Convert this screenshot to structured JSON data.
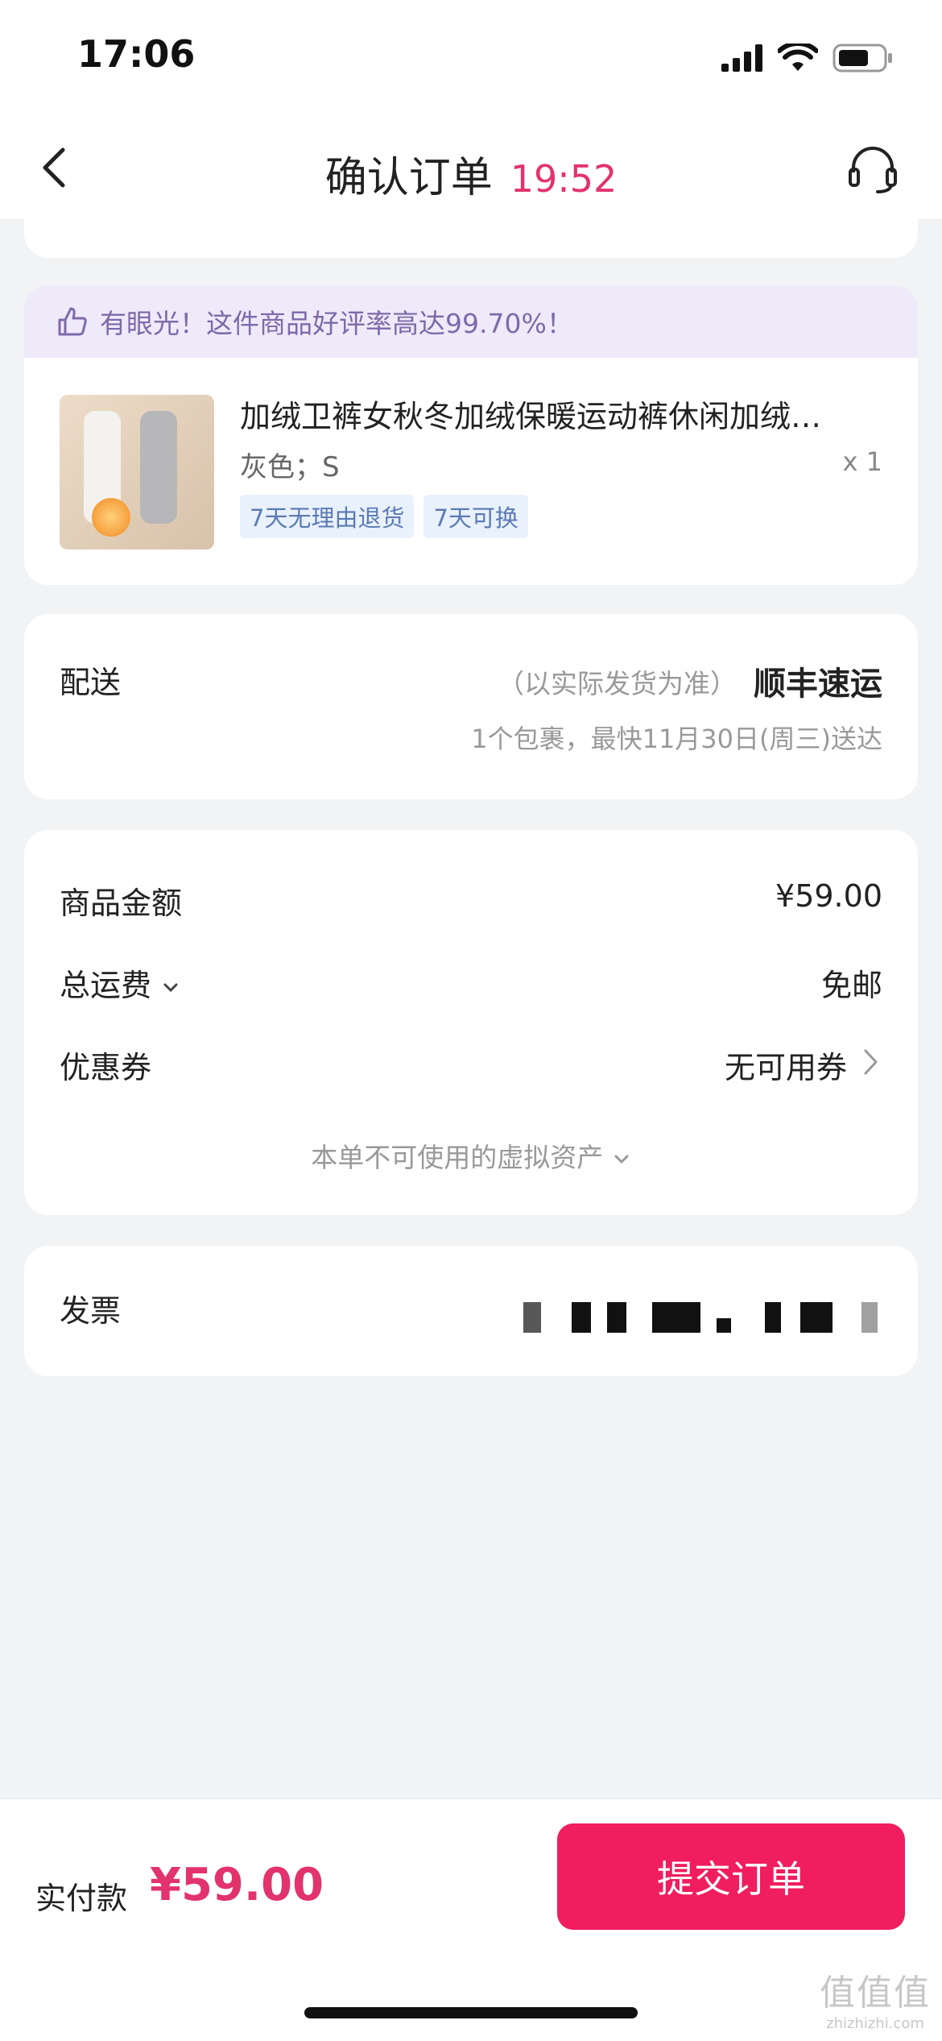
{
  "status_bar": {
    "time": "17:06"
  },
  "header": {
    "title": "确认订单",
    "timer": "19:52"
  },
  "banner": {
    "text": "有眼光！这件商品好评率高达99.70%！"
  },
  "product": {
    "title": "加绒卫裤女秋冬加绒保暖运动裤休闲加绒…",
    "spec": "灰色；S",
    "qty": "x 1",
    "tags": [
      "7天无理由退货",
      "7天可换"
    ]
  },
  "shipping": {
    "label": "配送",
    "note": "（以实际发货为准）",
    "carrier": "顺丰速运",
    "detail": "1个包裹，最快11月30日(周三)送达"
  },
  "summary": {
    "goods_label": "商品金额",
    "goods_value": "¥59.00",
    "freight_label": "总运费",
    "freight_value": "免邮",
    "coupon_label": "优惠券",
    "coupon_value": "无可用券",
    "virtual_assets": "本单不可使用的虚拟资产"
  },
  "invoice": {
    "label": "发票"
  },
  "footer": {
    "pay_label": "实付款",
    "pay_amount": "¥59.00",
    "submit_label": "提交订单"
  },
  "colors": {
    "accent": "#e2336d",
    "button": "#f01d5f",
    "banner_bg": "#efeafa"
  },
  "icons": [
    "back-arrow-icon",
    "headset-icon",
    "thumbs-up-icon",
    "chevron-down-icon",
    "chevron-right-icon",
    "signal-icon",
    "wifi-icon",
    "battery-icon"
  ]
}
